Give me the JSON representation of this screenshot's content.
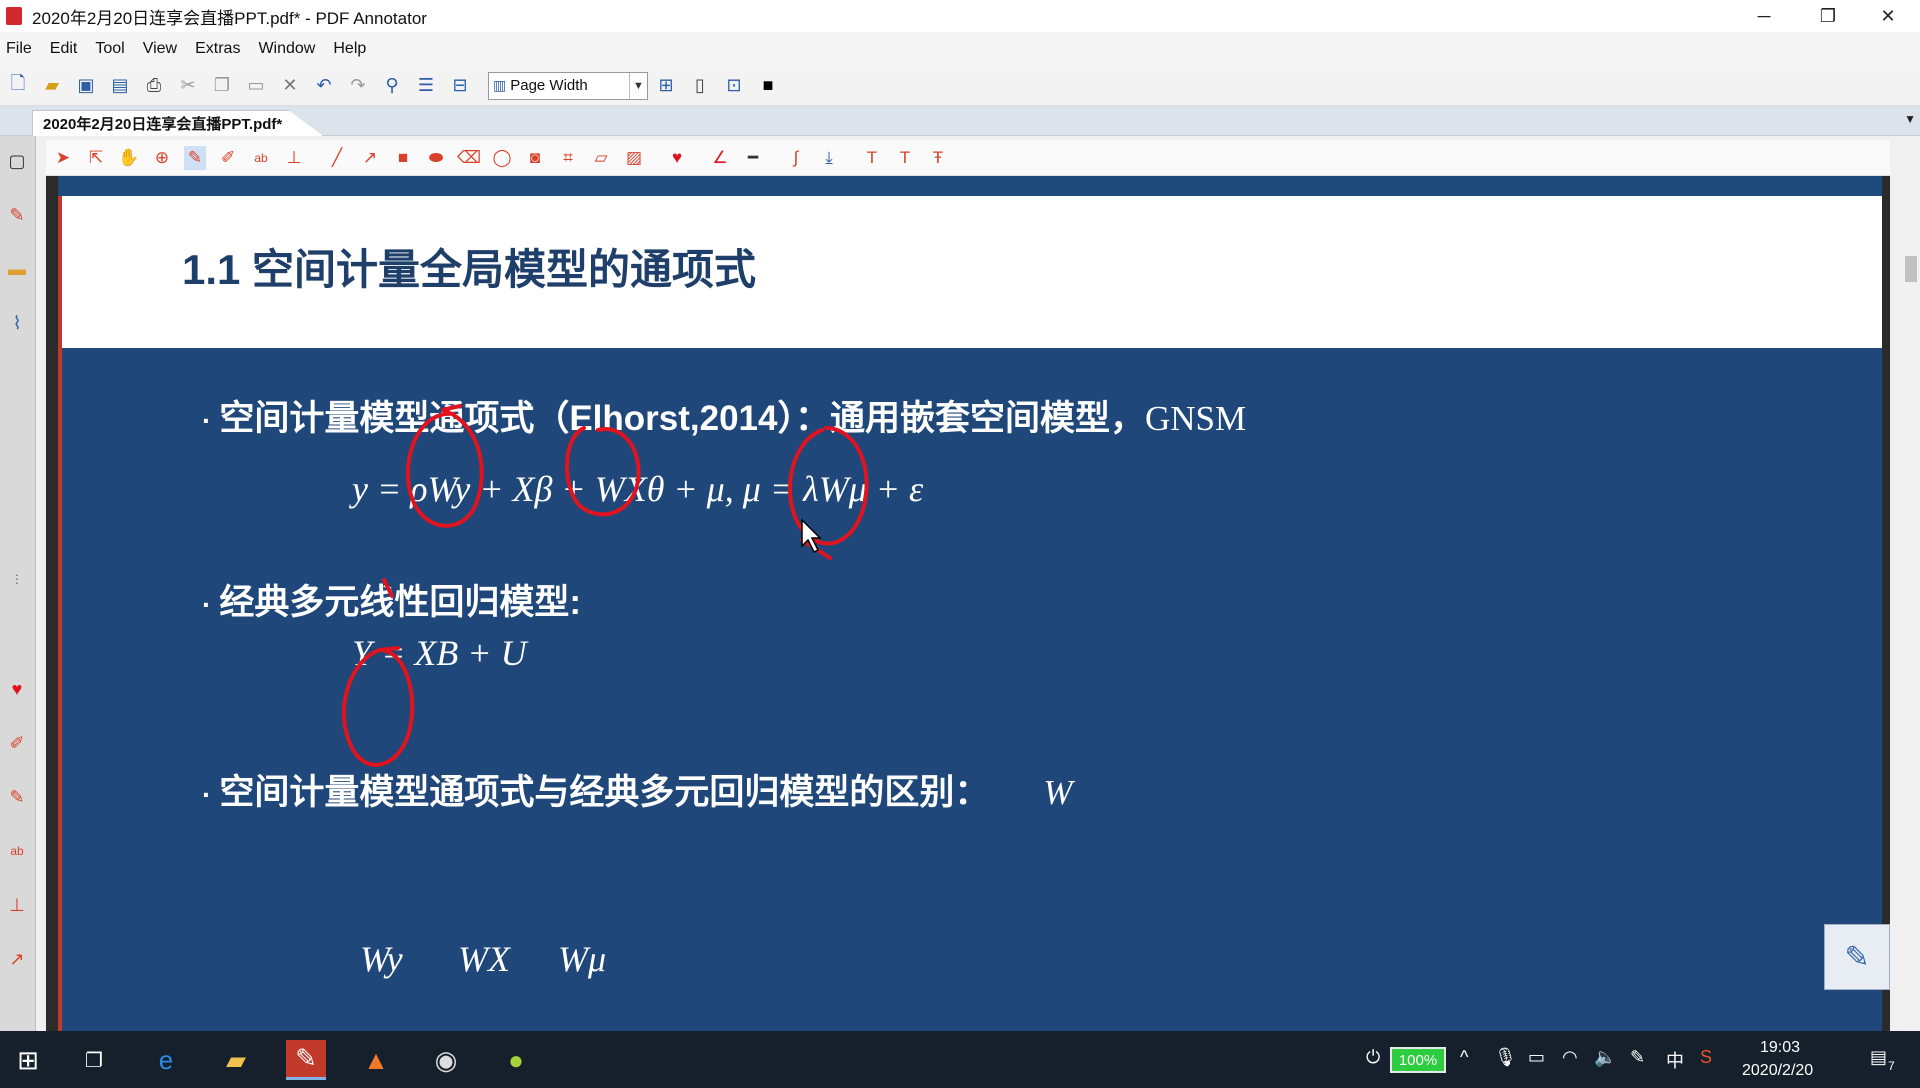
{
  "window": {
    "title": "2020年2月20日连享会直播PPT.pdf* - PDF Annotator",
    "minimize": "─",
    "restore": "❐",
    "close": "✕"
  },
  "menu": [
    "File",
    "Edit",
    "Tool",
    "View",
    "Extras",
    "Window",
    "Help"
  ],
  "toolbar": {
    "zoom_value": "Page Width"
  },
  "tab": {
    "label": "2020年2月20日连享会直播PPT.pdf*"
  },
  "slide": {
    "title": "1.1 空间计量全局模型的通项式",
    "bullets": [
      {
        "text": "空间计量模型通项式（Elhorst,2014）：通用嵌套空间模型，",
        "tail": "GNSM"
      },
      {
        "text": "经典多元线性回归模型:",
        "tail": ""
      },
      {
        "text": "空间计量模型通项式与经典多元回归模型的区别：",
        "tail": "W"
      }
    ],
    "formula_gnsm": "y = ρWy + Xβ + WXθ + μ, μ = λWμ + ε",
    "formula_ols": "Y = XB + U",
    "formula_terms": [
      "Wy",
      "WX",
      "Wμ"
    ]
  },
  "taskbar": {
    "battery": "100%",
    "ime": "中",
    "time": "19:03",
    "date": "2020/2/20",
    "notifications": "7"
  },
  "colors": {
    "slide_body": "#1f477a",
    "slide_title": "#1f3f6b",
    "annotation": "#e0141e",
    "accent": "#2d5fa8"
  }
}
